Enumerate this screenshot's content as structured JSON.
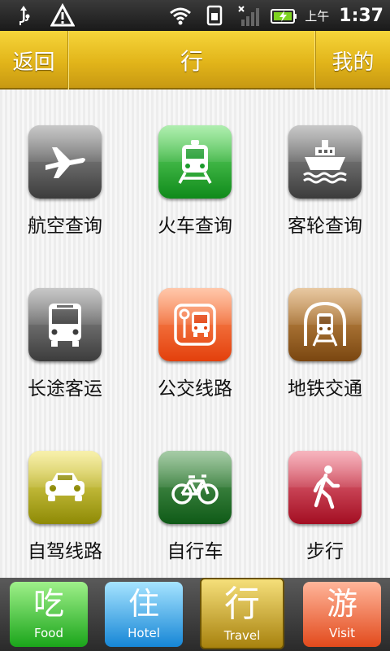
{
  "status_bar": {
    "ampm": "上午",
    "time": "1:37"
  },
  "title_bar": {
    "back_label": "返回",
    "title": "行",
    "mine_label": "我的"
  },
  "grid": {
    "items": [
      {
        "label": "航空查询",
        "icon": "airplane-icon",
        "color": "#3c3c3c"
      },
      {
        "label": "火车查询",
        "icon": "train-icon",
        "color": "#0f8a1a"
      },
      {
        "label": "客轮查询",
        "icon": "ship-icon",
        "color": "#3c3c3c"
      },
      {
        "label": "长途客运",
        "icon": "bus-icon",
        "color": "#3c3c3c"
      },
      {
        "label": "公交线路",
        "icon": "bus-stop-icon",
        "color": "#e3400c"
      },
      {
        "label": "地铁交通",
        "icon": "subway-icon",
        "color": "#7a4610"
      },
      {
        "label": "自驾线路",
        "icon": "car-icon",
        "color": "#8e8a05"
      },
      {
        "label": "自行车",
        "icon": "bicycle-icon",
        "color": "#0f5a17"
      },
      {
        "label": "步行",
        "icon": "walking-icon",
        "color": "#a30e22"
      }
    ]
  },
  "tab_bar": {
    "tabs": [
      {
        "glyph": "吃",
        "label": "Food",
        "color": "#1aa51a"
      },
      {
        "glyph": "住",
        "label": "Hotel",
        "color": "#1686d6"
      },
      {
        "glyph": "行",
        "label": "Travel",
        "color": "#a8820e",
        "selected": true
      },
      {
        "glyph": "游",
        "label": "Visit",
        "color": "#e24a1c"
      }
    ]
  }
}
